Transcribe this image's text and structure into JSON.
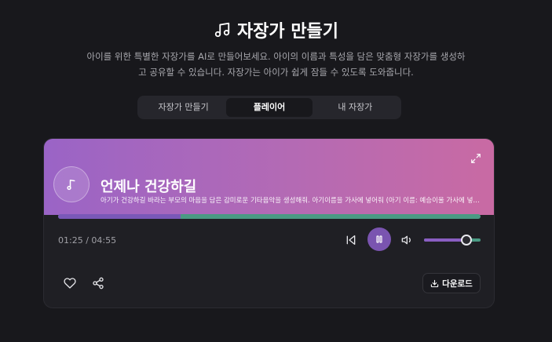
{
  "header": {
    "title": "자장가 만들기",
    "title_icon": "music-note-icon",
    "subtitle_line1": "아이를 위한 특별한 자장가를 AI로 만들어보세요. 아이의 이름과 특성을 담은 맞춤형 자장가를 생성하",
    "subtitle_line2": "고 공유할 수 있습니다. 자장가는 아이가 쉽게 잠들 수 있도록 도와줍니다."
  },
  "tabs": [
    {
      "label": "자장가 만들기",
      "active": false
    },
    {
      "label": "플레이어",
      "active": true
    },
    {
      "label": "내 자장가",
      "active": false
    }
  ],
  "player": {
    "song_title": "언제나 건강하길",
    "song_description": "아기가 건강하길 바라는 부모의 마음을 담은 감미로운 기타음악을 생성해줘. 아기이름을 가사에 넣어줘 (아기 이름: 예승이울 가사에 넣어줘)",
    "current_time": "01:25",
    "total_time": "04:55",
    "time_display": "01:25 / 04:55",
    "progress": 0.29,
    "volume": 0.75,
    "download_label": "다운로드",
    "icons": {
      "expand": "expand-icon",
      "note": "music-note-icon",
      "prev": "skip-back-icon",
      "play_pause": "pause-icon",
      "volume": "volume-icon",
      "heart": "heart-icon",
      "share": "share-icon",
      "download": "download-icon"
    }
  },
  "colors": {
    "background": "#18181c",
    "card": "#1f1f24",
    "accent_purple": "#7a54b0",
    "progress_track": "#4a9a84",
    "banner_start": "#9a64c6",
    "banner_end": "#c96aa3"
  }
}
